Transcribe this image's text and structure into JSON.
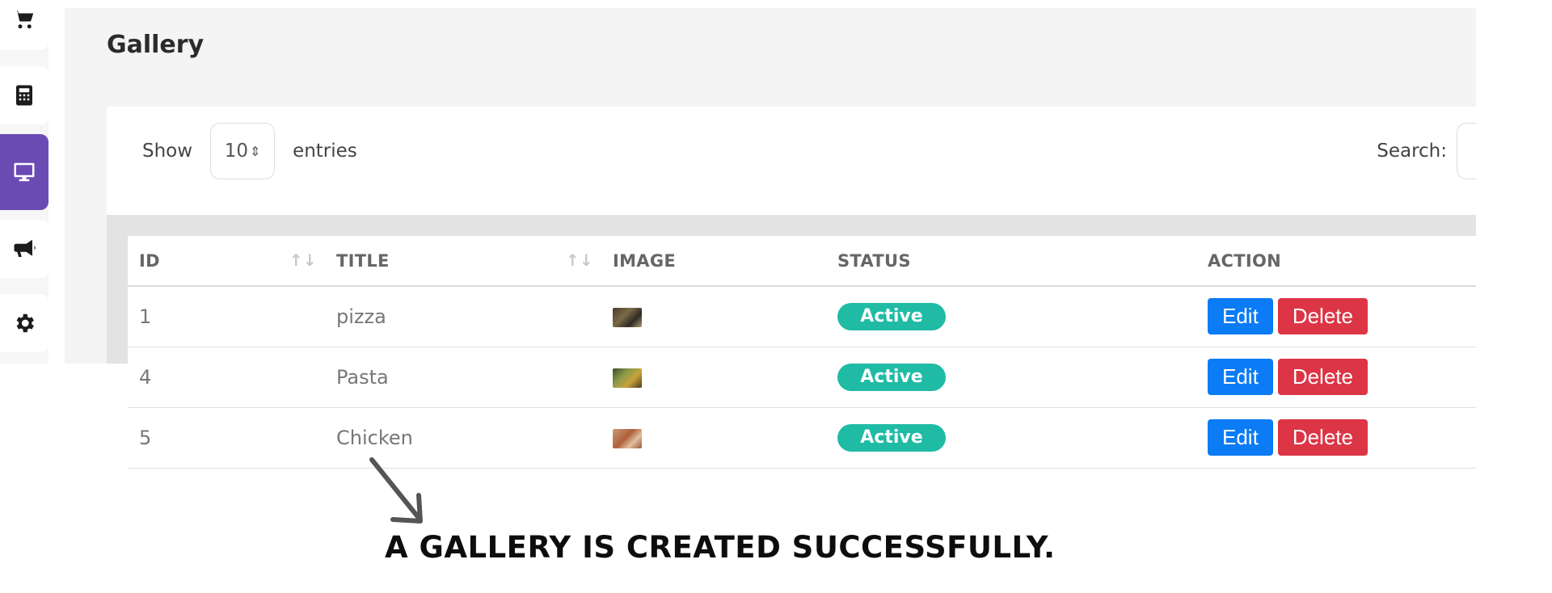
{
  "sidebar": {
    "items": [
      {
        "icon": "cart-icon"
      },
      {
        "icon": "calculator-icon"
      },
      {
        "icon": "monitor-icon",
        "active": true
      },
      {
        "icon": "megaphone-icon"
      },
      {
        "icon": "gear-icon"
      }
    ],
    "active_color": "#6a4bb4"
  },
  "page": {
    "title": "Gallery"
  },
  "controls": {
    "show_label": "Show",
    "entries_value": "10",
    "entries_label": "entries",
    "search_label": "Search:"
  },
  "table": {
    "headers": [
      "ID",
      "TITLE",
      "IMAGE",
      "STATUS",
      "ACTION"
    ],
    "rows": [
      {
        "id": "1",
        "title": "pizza",
        "status": "Active",
        "edit": "Edit",
        "delete": "Delete"
      },
      {
        "id": "4",
        "title": "Pasta",
        "status": "Active",
        "edit": "Edit",
        "delete": "Delete"
      },
      {
        "id": "5",
        "title": "Chicken",
        "status": "Active",
        "edit": "Edit",
        "delete": "Delete"
      }
    ]
  },
  "colors": {
    "status_active": "#1fbba5",
    "edit": "#0b7bf6",
    "delete": "#dc3546"
  },
  "annotation": {
    "text": "A GALLERY IS CREATED SUCCESSFULLY."
  }
}
